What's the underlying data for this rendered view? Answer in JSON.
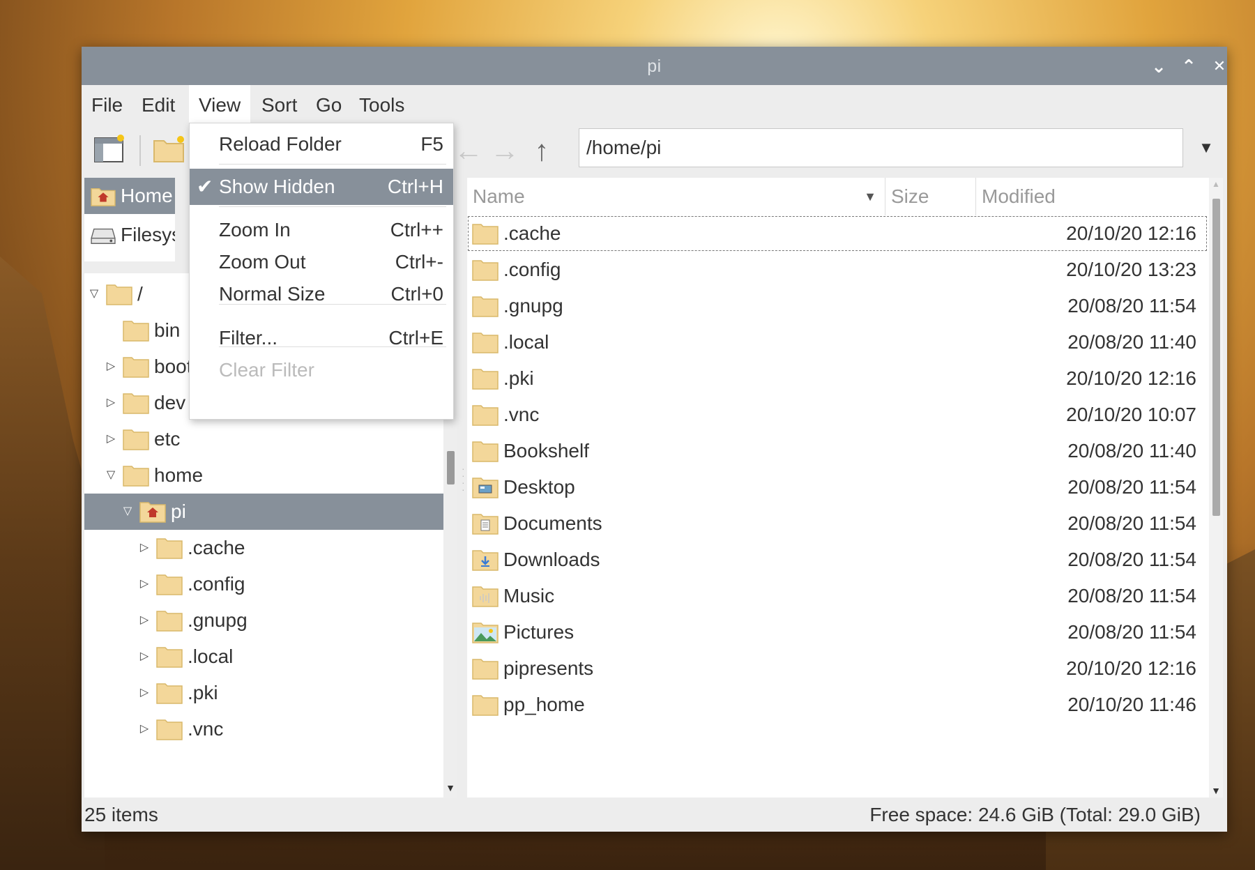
{
  "window": {
    "title": "pi"
  },
  "window_controls": [
    {
      "icon": "minimize-icon",
      "glyph": "⌄"
    },
    {
      "icon": "maximize-icon",
      "glyph": "⌃"
    },
    {
      "icon": "close-icon",
      "glyph": "✕"
    }
  ],
  "menubar": {
    "items": [
      "File",
      "Edit",
      "View",
      "Sort",
      "Go",
      "Tools"
    ],
    "active": "View"
  },
  "toolbar": {
    "back_icon": "←",
    "forward_icon": "→",
    "up_icon": "↑",
    "path": "/home/pi",
    "path_dropdown_icon": "▼"
  },
  "view_menu": {
    "items": [
      {
        "check": "",
        "label": "Reload Folder",
        "accel": "F5",
        "state": "normal"
      },
      {
        "check": "✔",
        "label": "Show Hidden",
        "accel": "Ctrl+H",
        "state": "highlighted"
      },
      {
        "check": "",
        "label": "Zoom In",
        "accel": "Ctrl++",
        "state": "normal"
      },
      {
        "check": "",
        "label": "Zoom Out",
        "accel": "Ctrl+-",
        "state": "normal"
      },
      {
        "check": "",
        "label": "Normal Size",
        "accel": "Ctrl+0",
        "state": "normal"
      },
      {
        "check": "",
        "label": "Filter...",
        "accel": "Ctrl+E",
        "state": "normal"
      },
      {
        "check": "",
        "label": "Clear Filter",
        "accel": "",
        "state": "disabled"
      }
    ]
  },
  "places": [
    {
      "label": "Home Folder",
      "icon": "home-icon",
      "selected": true
    },
    {
      "label": "Filesystem Root",
      "icon": "drive-icon",
      "selected": false
    }
  ],
  "tree": [
    {
      "label": "/",
      "expander": "▽",
      "indent": 0,
      "selected": false,
      "icon": "folder-icon"
    },
    {
      "label": "bin",
      "expander": "",
      "indent": 1,
      "selected": false,
      "icon": "folder-icon"
    },
    {
      "label": "boot",
      "expander": "▷",
      "indent": 1,
      "selected": false,
      "icon": "folder-icon"
    },
    {
      "label": "dev",
      "expander": "▷",
      "indent": 1,
      "selected": false,
      "icon": "folder-icon"
    },
    {
      "label": "etc",
      "expander": "▷",
      "indent": 1,
      "selected": false,
      "icon": "folder-icon"
    },
    {
      "label": "home",
      "expander": "▽",
      "indent": 1,
      "selected": false,
      "icon": "folder-icon"
    },
    {
      "label": "pi",
      "expander": "▽",
      "indent": 2,
      "selected": true,
      "icon": "home-folder-icon"
    },
    {
      "label": ".cache",
      "expander": "▷",
      "indent": 3,
      "selected": false,
      "icon": "folder-icon"
    },
    {
      "label": ".config",
      "expander": "▷",
      "indent": 3,
      "selected": false,
      "icon": "folder-icon"
    },
    {
      "label": ".gnupg",
      "expander": "▷",
      "indent": 3,
      "selected": false,
      "icon": "folder-icon"
    },
    {
      "label": ".local",
      "expander": "▷",
      "indent": 3,
      "selected": false,
      "icon": "folder-icon"
    },
    {
      "label": ".pki",
      "expander": "▷",
      "indent": 3,
      "selected": false,
      "icon": "folder-icon"
    },
    {
      "label": ".vnc",
      "expander": "▷",
      "indent": 3,
      "selected": false,
      "icon": "folder-icon"
    }
  ],
  "columns": {
    "name": "Name",
    "size": "Size",
    "modified": "Modified",
    "sort_indicator": "▼"
  },
  "files": [
    {
      "name": ".cache",
      "modified": "20/10/20 12:16",
      "icon": "folder-icon"
    },
    {
      "name": ".config",
      "modified": "20/10/20 13:23",
      "icon": "folder-icon"
    },
    {
      "name": ".gnupg",
      "modified": "20/08/20 11:54",
      "icon": "folder-icon"
    },
    {
      "name": ".local",
      "modified": "20/08/20 11:40",
      "icon": "folder-icon"
    },
    {
      "name": ".pki",
      "modified": "20/10/20 12:16",
      "icon": "folder-icon"
    },
    {
      "name": ".vnc",
      "modified": "20/10/20 10:07",
      "icon": "folder-icon"
    },
    {
      "name": "Bookshelf",
      "modified": "20/08/20 11:40",
      "icon": "folder-icon"
    },
    {
      "name": "Desktop",
      "modified": "20/08/20 11:54",
      "icon": "desktop-folder-icon"
    },
    {
      "name": "Documents",
      "modified": "20/08/20 11:54",
      "icon": "documents-folder-icon"
    },
    {
      "name": "Downloads",
      "modified": "20/08/20 11:54",
      "icon": "downloads-folder-icon"
    },
    {
      "name": "Music",
      "modified": "20/08/20 11:54",
      "icon": "music-folder-icon"
    },
    {
      "name": "Pictures",
      "modified": "20/08/20 11:54",
      "icon": "pictures-folder-icon"
    },
    {
      "name": "pipresents",
      "modified": "20/10/20 12:16",
      "icon": "folder-icon"
    },
    {
      "name": "pp_home",
      "modified": "20/10/20 11:46",
      "icon": "folder-icon"
    }
  ],
  "status": {
    "items": "25 items",
    "free_space": "Free space: 24.6 GiB (Total: 29.0 GiB)"
  },
  "colors": {
    "titlebar": "#87909a",
    "selection": "#87909a",
    "folder": "#f3d79a",
    "folder_edge": "#d9b86a",
    "home_red": "#c0392b"
  }
}
